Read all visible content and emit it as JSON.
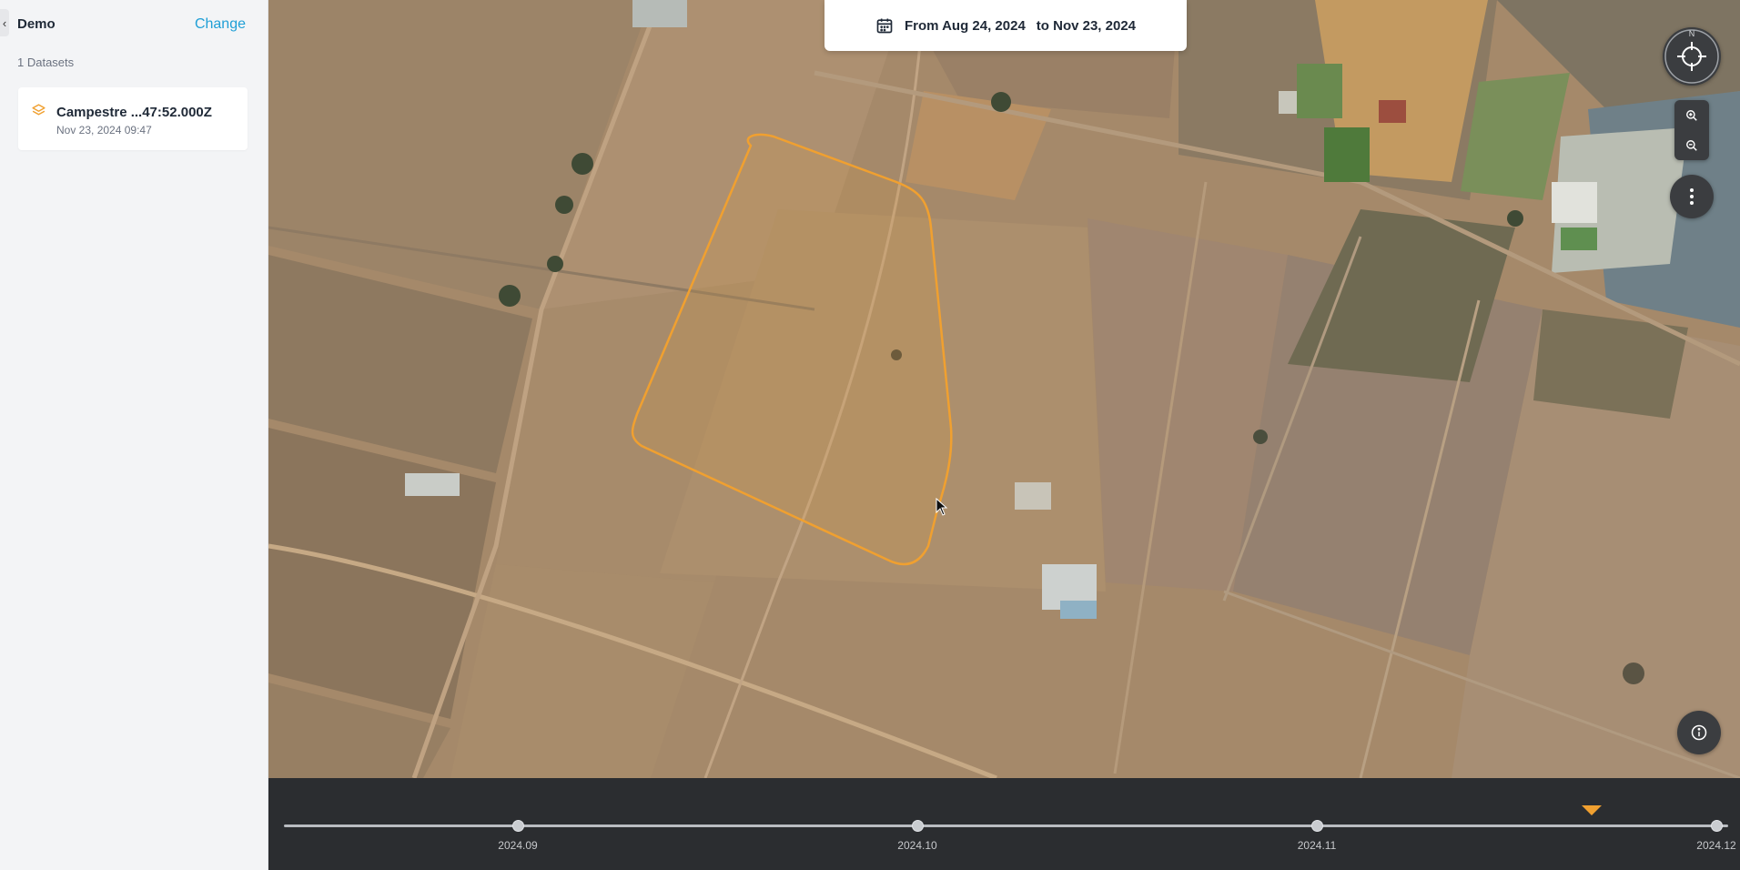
{
  "sidebar": {
    "project_name": "Demo",
    "change_label": "Change",
    "dataset_count": "1 Datasets",
    "dataset": {
      "name": "Campestre ...47:52.000Z",
      "date": "Nov 23, 2024 09:47",
      "icon": "layers-icon"
    }
  },
  "map": {
    "date_range": {
      "from_label": "From Aug 24, 2024",
      "to_label": "to Nov 23, 2024",
      "icon": "calendar-icon"
    },
    "compass_label": "N",
    "aoi_color": "#f0a030"
  },
  "timeline": {
    "ticks": [
      "2024.09",
      "2024.10",
      "2024.11",
      "2024.12"
    ],
    "marker_color": "#f0a030"
  },
  "colors": {
    "accent": "#1f9fd6",
    "dataset_icon": "#f0a030",
    "control_bg": "#3b3d40",
    "timeline_bg": "#2b2d30"
  }
}
